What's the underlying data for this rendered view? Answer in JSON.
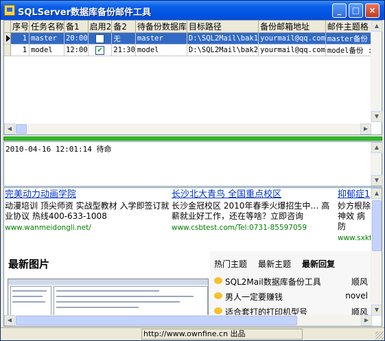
{
  "window": {
    "title": "SQLServer数据库备份邮件工具"
  },
  "grid": {
    "columns": [
      "序号",
      "任务名称",
      "备1",
      "启用2",
      "备2",
      "待备份数据库",
      "目标路径",
      "备份邮箱地址",
      "邮件主题格"
    ],
    "rows": [
      {
        "selected": true,
        "cells": [
          "1",
          "master",
          "20:00",
          "",
          "无",
          "master",
          "D:\\SQL2Mail\\bak1",
          "yourmail@qq.com",
          "master备份"
        ],
        "checked": false
      },
      {
        "selected": false,
        "cells": [
          "1",
          "model",
          "12:00",
          "",
          "21:30",
          "model",
          "D:\\SQL2Mail\\bak2",
          "yourmail@qq.com",
          "model备份 :"
        ],
        "checked": true
      }
    ]
  },
  "log": {
    "text": "2010-04-16 12:01:14 待命"
  },
  "ads": [
    {
      "title": "完美动力动画学院",
      "desc": "动漫培训 顶尖师资 实战型教材 入学即签订就业协议 热线400-633-1008",
      "url": "www.wanmeidongli.net/"
    },
    {
      "title": "长沙北大青鸟 全国重点校区",
      "desc": "长沙金冠校区 2010年春季火爆招生中… 高薪就业好工作，还在等啥？立即咨询",
      "url": "www.csbtest.com/Tel:0731-85597059"
    },
    {
      "title": "抑郁症1",
      "desc": "妙方根除 神效 病防",
      "url": "www.sxkfzx"
    }
  ],
  "web": {
    "new_pics": "最新图片",
    "tabs": [
      {
        "label": "热门主题",
        "active": false
      },
      {
        "label": "最新主题",
        "active": false
      },
      {
        "label": "最新回复",
        "active": true
      }
    ],
    "topics": [
      {
        "title": "SQL2Mail数据库备份工具",
        "user": "顺风"
      },
      {
        "title": "男人一定要赚钱",
        "user": "novel"
      },
      {
        "title": "适合套打的打印机型号",
        "user": "顺风"
      }
    ]
  },
  "status": {
    "text": "http://www.ownfine.cn 出品"
  },
  "colors": {
    "titlebar": "#0054e3",
    "selection": "#316ac5",
    "progress": "#2fbf28"
  }
}
